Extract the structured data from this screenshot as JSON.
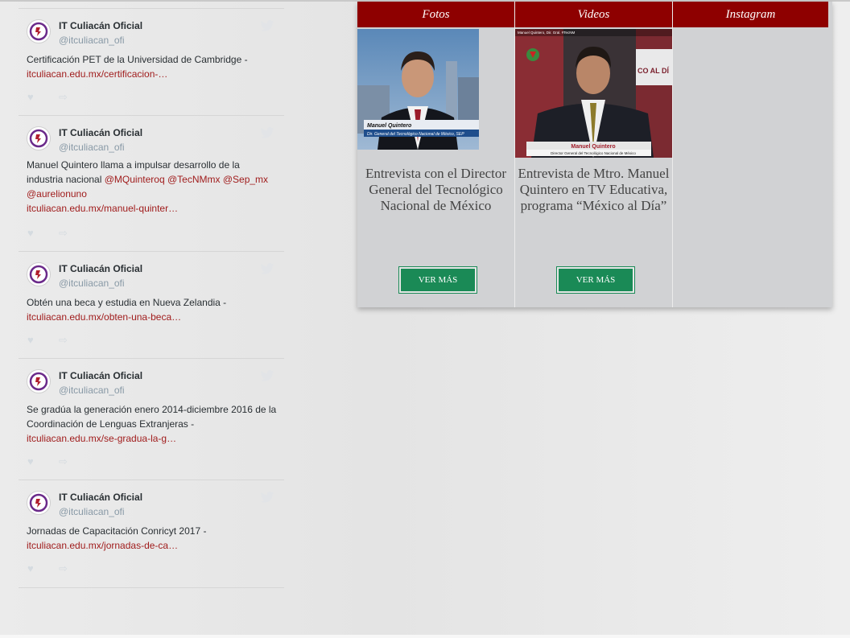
{
  "timeline": {
    "tweets": [
      {
        "author": "IT Culiacán Oficial",
        "handle": "@itculiacan_ofi",
        "text": "Certificación PET de la Universidad de Cambridge - ",
        "link": "itculiacan.edu.mx/certificacion-…"
      },
      {
        "author": "IT Culiacán Oficial",
        "handle": "@itculiacan_ofi",
        "text": "Manuel Quintero llama a impulsar desarrollo de la industria nacional ",
        "mentions": [
          "@MQuinteroq",
          "@TecNMmx",
          "@Sep_mx",
          "@aurelionuno"
        ],
        "link": "itculiacan.edu.mx/manuel-quinter…"
      },
      {
        "author": "IT Culiacán Oficial",
        "handle": "@itculiacan_ofi",
        "text": "Obtén una beca y estudia en Nueva Zelandia - ",
        "link": "itculiacan.edu.mx/obten-una-beca…"
      },
      {
        "author": "IT Culiacán Oficial",
        "handle": "@itculiacan_ofi",
        "text": "Se gradúa la generación enero 2014-diciembre 2016 de la Coordinación de Lenguas Extranjeras - ",
        "link": "itculiacan.edu.mx/se-gradua-la-g…"
      },
      {
        "author": "IT Culiacán Oficial",
        "handle": "@itculiacan_ofi",
        "text": "Jornadas de Capacitación Conricyt 2017 - ",
        "link": "itculiacan.edu.mx/jornadas-de-ca…"
      }
    ]
  },
  "media": {
    "tabs": [
      "Fotos",
      "Videos",
      "Instagram"
    ],
    "fotos": {
      "caption_name": "Manuel Quintero",
      "caption_role": "Dir. General del Tecnológico Nacional de México, SEP",
      "title": "Entrevista con el Director General del Tecnológico Nacional de México",
      "button": "VER MÁS"
    },
    "videos": {
      "overlay": "Manuel Quintero, Dir. Gral. #TecNM",
      "banner": "CO AL DÍ",
      "caption_name": "Manuel Quintero",
      "caption_role": "Director General del Tecnológico Nacional de México",
      "title": "Entrevista de Mtro. Manuel Quintero en TV Educativa, programa “México al Día”",
      "button": "VER MÁS"
    }
  },
  "colors": {
    "header_bg": "#8e0000",
    "button_bg": "#1a8a56",
    "link": "#a01c1c",
    "panel_bg": "#d1d2d4"
  }
}
